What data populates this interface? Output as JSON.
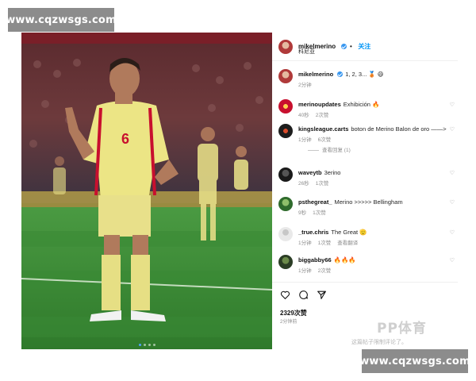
{
  "watermarks": {
    "top": "www.cqzwsgs.com",
    "bottom": "www.cqzwsgs.com",
    "logo": "PP体育"
  },
  "post": {
    "author": "mikelmerino",
    "follow_label": "关注",
    "location": "科尼亚",
    "jersey_number": "6",
    "carousel": {
      "count": 4,
      "active": 1
    }
  },
  "comments": [
    {
      "user": "mikelmerino",
      "text": "1, 2, 3... 🥉 😄",
      "time": "2分钟",
      "verified": true
    },
    {
      "user": "merinoupdates",
      "text": "Exhibición 🔥",
      "time": "40秒",
      "likes": "2次赞"
    },
    {
      "user": "kingsleague.carts",
      "text": "boton de Merino Balon de oro ——>",
      "time": "1分钟",
      "likes": "6次赞",
      "replies": "查看回复 (1)"
    },
    {
      "user": "waveytb",
      "text": "3erino",
      "time": "26秒",
      "likes": "1次赞"
    },
    {
      "user": "psthegreat_",
      "text": "Merino >>>>> Bellingham",
      "time": "9秒",
      "likes": "1次赞"
    },
    {
      "user": "_true.chris",
      "text": "The Great 🫡",
      "time": "1分钟",
      "likes": "1次赞",
      "translate": "查看翻译"
    },
    {
      "user": "biggabby66",
      "text": "🔥🔥🔥",
      "time": "1分钟",
      "likes": "2次赞"
    }
  ],
  "footer": {
    "likes": "2329次赞",
    "ago": "2分钟前",
    "add_comment": "这篇帖子限制评论了。"
  },
  "colors": {
    "link_blue": "#0095f6",
    "verified_blue": "#3897f0",
    "jersey": "#e8e08a",
    "pitch": "#3f8f3a"
  },
  "icons": [
    "heart-icon",
    "comment-icon",
    "share-icon",
    "verified-badge-icon",
    "comment-like-heart-icon"
  ]
}
